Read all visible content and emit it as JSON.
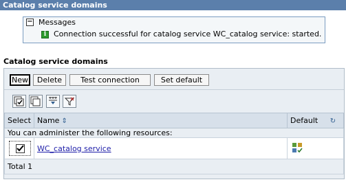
{
  "window": {
    "title": "Catalog service domains"
  },
  "messages": {
    "header": "Messages",
    "toggle_glyph": "−",
    "icon_glyph": "i",
    "items": [
      {
        "text": "Connection successful for catalog service WC_catalog service: started."
      }
    ]
  },
  "section": {
    "title": "Catalog service domains"
  },
  "toolbar": {
    "new_label": "New",
    "delete_label": "Delete",
    "test_connection_label": "Test connection",
    "set_default_label": "Set default"
  },
  "icons": [
    "select-all-icon",
    "deselect-all-icon",
    "show-filter-icon",
    "clear-filter-icon"
  ],
  "table": {
    "columns": {
      "select": "Select",
      "name": "Name",
      "default": "Default"
    },
    "name_sort_glyph": "⇕",
    "default_sort_glyph": "↻",
    "resource_note": "You can administer the following resources:",
    "rows": [
      {
        "name": "WC_catalog service",
        "checked": true,
        "default_icon": "default-indicator-icon"
      }
    ],
    "total": "Total 1"
  },
  "colors": {
    "titlebar": "#5b7fab",
    "panel": "#e9eef3",
    "header": "#d7e0ea",
    "link": "#1c1ca8",
    "info_icon": "#2d9a2d"
  }
}
